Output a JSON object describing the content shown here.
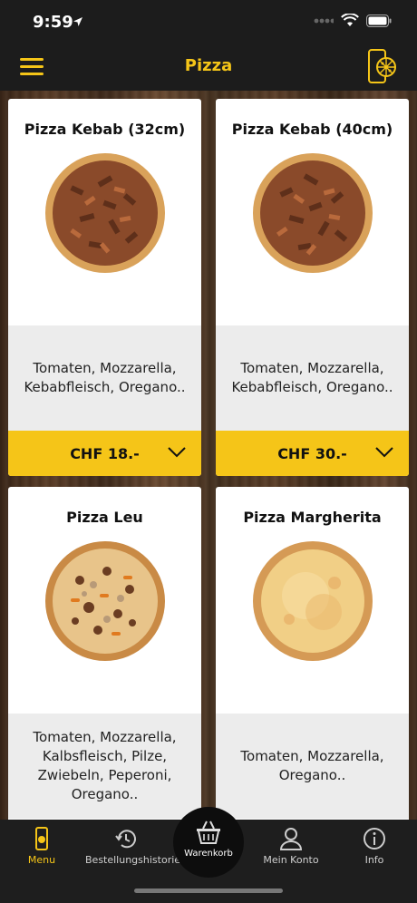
{
  "status_bar": {
    "time": "9:59"
  },
  "nav": {
    "title": "Pizza"
  },
  "products": [
    {
      "name": "Pizza Kebab (32cm)",
      "description": "Tomaten, Mozzarella, Kebabfleisch, Oregano..",
      "price": "CHF 18.-",
      "image": "pizza-kebab"
    },
    {
      "name": "Pizza Kebab (40cm)",
      "description": "Tomaten, Mozzarella, Kebabfleisch, Oregano..",
      "price": "CHF 30.-",
      "image": "pizza-kebab"
    },
    {
      "name": "Pizza Leu",
      "description": "Tomaten, Mozzarella, Kalbsfleisch, Pilze, Zwiebeln, Peperoni, Oregano..",
      "price": "",
      "image": "pizza-leu"
    },
    {
      "name": "Pizza Margherita",
      "description": "Tomaten, Mozzarella, Oregano..",
      "price": "",
      "image": "pizza-margherita"
    }
  ],
  "tabs": [
    {
      "label": "Menu",
      "icon": "menu-phone-icon",
      "active": true
    },
    {
      "label": "Bestellungshistorie",
      "icon": "history-icon"
    },
    {
      "label": "Warenkorb",
      "icon": "basket-icon"
    },
    {
      "label": "Mein Konto",
      "icon": "account-icon"
    },
    {
      "label": "Info",
      "icon": "info-icon"
    }
  ],
  "colors": {
    "accent": "#f5c518",
    "bar": "#1c1c1c",
    "card_desc_bg": "#ececec"
  }
}
